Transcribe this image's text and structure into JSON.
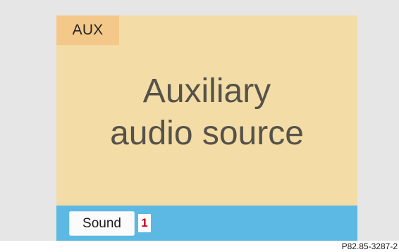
{
  "screen": {
    "mode_tab": "AUX",
    "title_line1": "Auxiliary",
    "title_line2": "audio source"
  },
  "bottom_bar": {
    "sound_button_label": "Sound",
    "callout_number": "1"
  },
  "reference_code": "P82.85-3287-2",
  "colors": {
    "screen_background": "#f3dca6",
    "mode_tab_background": "#f4c889",
    "bottom_bar_background": "#5cb9e3",
    "callout_text": "#c4001c"
  }
}
